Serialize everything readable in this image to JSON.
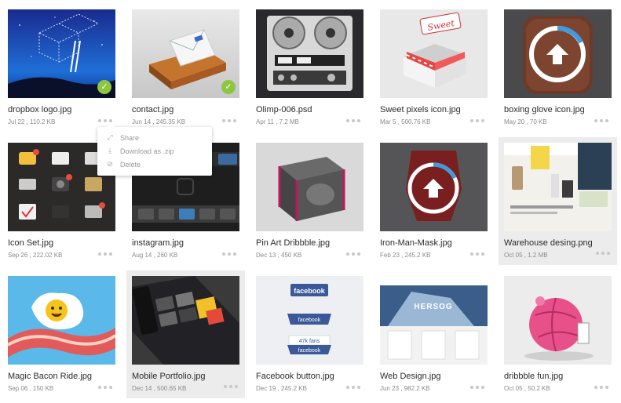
{
  "files": [
    {
      "name": "dropbox logo.jpg",
      "meta": "Jul 22 , 110.2 KB",
      "checked": true
    },
    {
      "name": "contact.jpg",
      "meta": "Jun 14 , 245.35 KB",
      "checked": true
    },
    {
      "name": "Olimp-006.psd",
      "meta": "Apr 11 , 7.2 MB"
    },
    {
      "name": "Sweet pixels icon.jpg",
      "meta": "Mar 5 , 500.76 KB"
    },
    {
      "name": "boxing glove icon.jpg",
      "meta": "May 20 , 70 KB"
    },
    {
      "name": "Icon Set.jpg",
      "meta": "Sep 26 , 222.02 KB"
    },
    {
      "name": "instagram.jpg",
      "meta": "Aug 14 , 260 KB"
    },
    {
      "name": "Pin Art Dribbble.jpg",
      "meta": "Dec 13 , 450 KB"
    },
    {
      "name": "Iron-Man-Mask.jpg",
      "meta": "Feb 23 , 245.2 KB"
    },
    {
      "name": "Warehouse desing.png",
      "meta": "Oct 05 , 1.2 MB",
      "selected": true
    },
    {
      "name": "Magic Bacon Ride.jpg",
      "meta": "Sep 06 , 150 KB"
    },
    {
      "name": "Mobile Portfolio.jpg",
      "meta": "Dec 14 , 500.65 KB",
      "selected": true
    },
    {
      "name": "Facebook button.jpg",
      "meta": "Dec 19 , 245.2 KB"
    },
    {
      "name": "Web Design.jpg",
      "meta": "Jun 23 , 982.2 KB"
    },
    {
      "name": "dribbble fun.jpg",
      "meta": "Oct 05 , 50.2 KB"
    }
  ],
  "context_menu": {
    "items": [
      {
        "label": "Share",
        "icon": "share-icon"
      },
      {
        "label": "Download as .zip",
        "icon": "download-icon"
      },
      {
        "label": "Delete",
        "icon": "delete-icon"
      }
    ]
  },
  "thumb_text": {
    "sweet_sign": "Sweet",
    "hersog": "HERSOG",
    "facebook": "facebook",
    "likes": "47k fans"
  },
  "colors": {
    "check": "#8dc63f",
    "selected_bg": "#ececec",
    "facebook_blue": "#3b5998"
  }
}
